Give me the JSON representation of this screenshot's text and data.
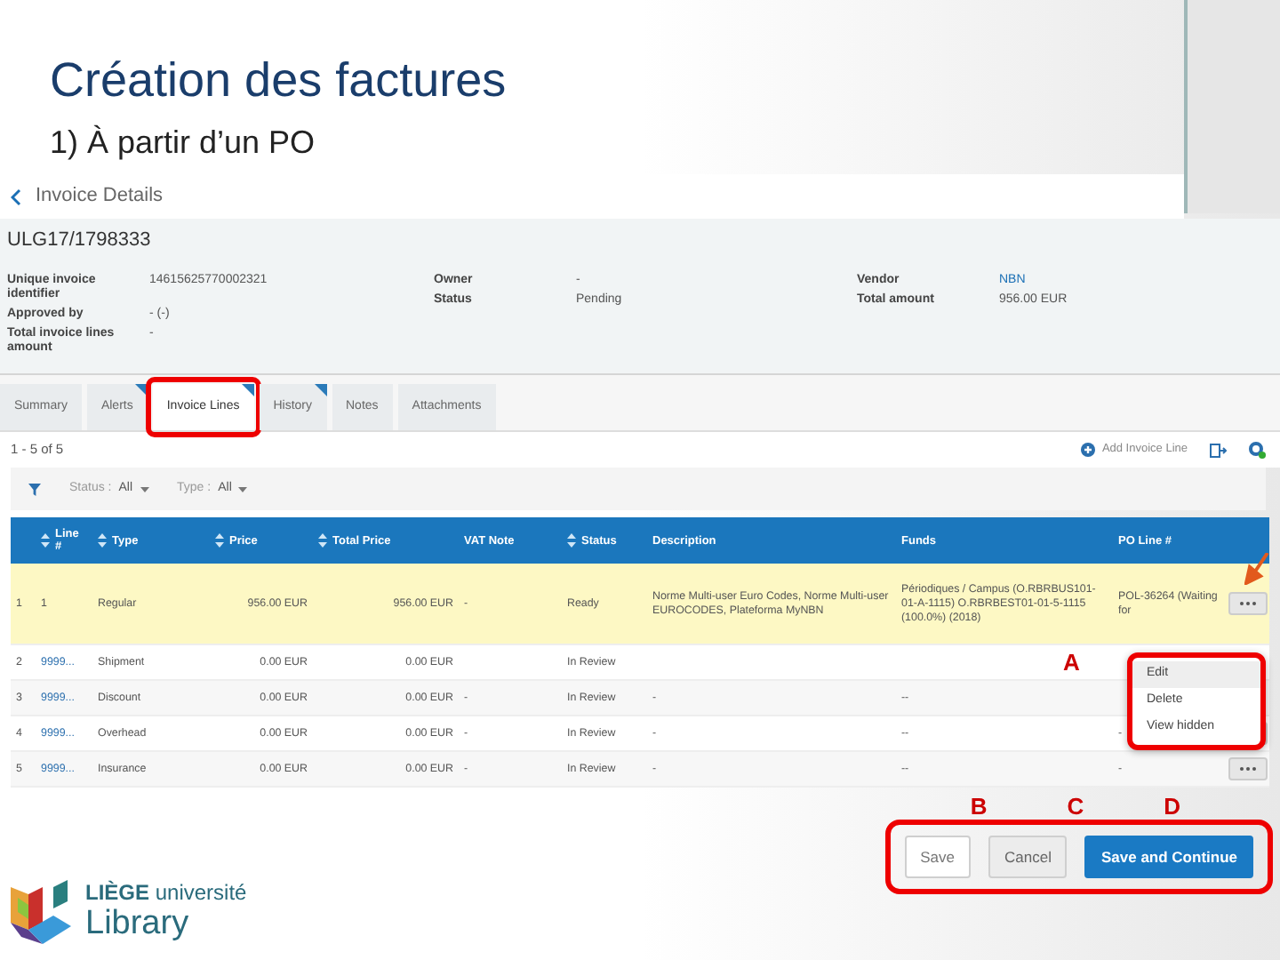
{
  "slide": {
    "title": "Création des factures",
    "subtitle": "1) À partir d’un PO"
  },
  "app": {
    "header": {
      "title": "Invoice Details"
    },
    "invoice_number": "ULG17/1798333",
    "fields": [
      {
        "label": "Unique invoice identifier",
        "value": "14615625770002321",
        "link": false
      },
      {
        "label": "Approved by",
        "value": "- (-)",
        "link": false
      },
      {
        "label": "Total invoice lines amount",
        "value": "-",
        "link": false
      },
      {
        "label": "Owner",
        "value": "-",
        "link": false
      },
      {
        "label": "Status",
        "value": "Pending",
        "link": false
      },
      {
        "label": "Vendor",
        "value": "NBN",
        "link": true
      },
      {
        "label": "Total amount",
        "value": "956.00 EUR",
        "link": false
      }
    ],
    "tabs": [
      {
        "label": "Summary",
        "selected": false,
        "flagged": false,
        "highlighted": false
      },
      {
        "label": "Alerts",
        "selected": false,
        "flagged": true,
        "highlighted": false
      },
      {
        "label": "Invoice Lines",
        "selected": true,
        "flagged": true,
        "highlighted": true
      },
      {
        "label": "History",
        "selected": false,
        "flagged": true,
        "highlighted": false
      },
      {
        "label": "Notes",
        "selected": false,
        "flagged": false,
        "highlighted": false
      },
      {
        "label": "Attachments",
        "selected": false,
        "flagged": false,
        "highlighted": false
      }
    ],
    "count": "1 - 5 of 5",
    "add_line": "Add Invoice Line",
    "filters": [
      {
        "label": "Status :",
        "value": "All"
      },
      {
        "label": "Type :",
        "value": "All"
      }
    ],
    "table": {
      "columns": [
        {
          "sortable": false
        },
        {
          "label": "Line #",
          "sortable": true
        },
        {
          "label": "Type",
          "sortable": true
        },
        {
          "label": "Price",
          "sortable": true
        },
        {
          "label": "Total Price",
          "sortable": true
        },
        {
          "label": "VAT Note",
          "sortable": false
        },
        {
          "label": "Status",
          "sortable": true
        },
        {
          "label": "Description",
          "sortable": false
        },
        {
          "label": "Funds",
          "sortable": false
        },
        {
          "label": "PO Line #",
          "sortable": false
        }
      ],
      "rows": [
        {
          "selected": true,
          "action": true,
          "cells": [
            "1",
            "1",
            "Regular",
            "956.00 EUR",
            "956.00 EUR",
            "-",
            "Ready",
            "Norme Multi-user Euro Codes, Norme Multi-user EUROCODES, Plateforma MyNBN",
            "Périodiques / Campus (O.RBRBUS101-01-A-1115) O.RBRBEST01-01-5-1115 (100.0%) (2018)",
            "POL-36264 (Waiting for"
          ]
        },
        {
          "selected": false,
          "action": false,
          "cells": [
            "2",
            "9999...",
            "Shipment",
            "0.00 EUR",
            "0.00 EUR",
            "",
            "In Review",
            "",
            "",
            ""
          ]
        },
        {
          "selected": false,
          "action": false,
          "cells": [
            "3",
            "9999...",
            "Discount",
            "0.00 EUR",
            "0.00 EUR",
            "-",
            "In Review",
            "-",
            "--",
            ""
          ]
        },
        {
          "selected": false,
          "action": true,
          "cells": [
            "4",
            "9999...",
            "Overhead",
            "0.00 EUR",
            "0.00 EUR",
            "-",
            "In Review",
            "-",
            "--",
            "-"
          ]
        },
        {
          "selected": false,
          "action": true,
          "cells": [
            "5",
            "9999...",
            "Insurance",
            "0.00 EUR",
            "0.00 EUR",
            "-",
            "In Review",
            "-",
            "--",
            "-"
          ]
        }
      ]
    },
    "row_menu": [
      {
        "label": "Edit",
        "selected": true
      },
      {
        "label": "Delete",
        "selected": false
      },
      {
        "label": "View hidden",
        "selected": false
      }
    ],
    "buttons": [
      {
        "label": "Save",
        "kind": "outline"
      },
      {
        "label": "Cancel",
        "kind": "muted"
      },
      {
        "label": "Save and Continue",
        "kind": "primary"
      }
    ]
  },
  "annotations": {
    "menu": "A",
    "buttons": [
      "B",
      "C",
      "D"
    ]
  },
  "logo": {
    "line1_bold": "LIÈGE",
    "line1": "université",
    "line2": "Library"
  }
}
